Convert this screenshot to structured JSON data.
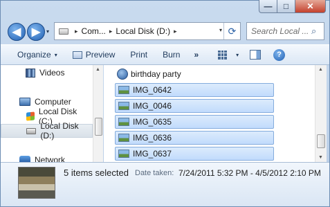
{
  "window": {
    "minimize_glyph": "—",
    "maximize_glyph": "□",
    "close_glyph": "✕"
  },
  "nav": {
    "back_glyph": "◀",
    "forward_glyph": "▶",
    "history_glyph": "▾"
  },
  "address": {
    "crumbs": [
      "Com...",
      "Local Disk (D:)"
    ],
    "separator": "▸",
    "drop_glyph": "▾",
    "refresh_glyph": "⟳"
  },
  "search": {
    "placeholder": "Search Local ...",
    "icon": "search-icon",
    "glyph": "⌕"
  },
  "toolbar": {
    "organize_label": "Organize",
    "preview_label": "Preview",
    "print_label": "Print",
    "burn_label": "Burn",
    "more_glyph": "»",
    "caret_glyph": "▾",
    "help_glyph": "?"
  },
  "sidebar": {
    "items": [
      {
        "label": "Videos",
        "icon": "video-icon"
      },
      {
        "label": "Computer",
        "icon": "computer-icon"
      },
      {
        "label": "Local Disk (C:)",
        "icon": "windows-drive-icon"
      },
      {
        "label": "Local Disk (D:)",
        "icon": "drive-icon",
        "selected": true
      },
      {
        "label": "Network",
        "icon": "network-icon"
      }
    ],
    "scroll_up_glyph": "▲"
  },
  "files": {
    "items": [
      {
        "name": "birthday party",
        "icon": "media-icon",
        "selected": false
      },
      {
        "name": "IMG_0642",
        "icon": "photo-icon",
        "selected": true
      },
      {
        "name": "IMG_0046",
        "icon": "photo-icon",
        "selected": true
      },
      {
        "name": "IMG_0635",
        "icon": "photo-icon",
        "selected": true
      },
      {
        "name": "IMG_0636",
        "icon": "photo-icon",
        "selected": true
      },
      {
        "name": "IMG_0637",
        "icon": "photo-icon",
        "selected": true
      }
    ],
    "scroll_up_glyph": "▲",
    "scroll_down_glyph": "▼"
  },
  "details": {
    "selection_text": "5 items selected",
    "date_label": "Date taken:",
    "date_value": "7/24/2011 5:32 PM - 4/5/2012 2:10 PM"
  },
  "colors": {
    "selection_fill": "#c9e0fc",
    "selection_border": "#84acdd",
    "frame": "#c9dbef",
    "close": "#c4412d"
  }
}
